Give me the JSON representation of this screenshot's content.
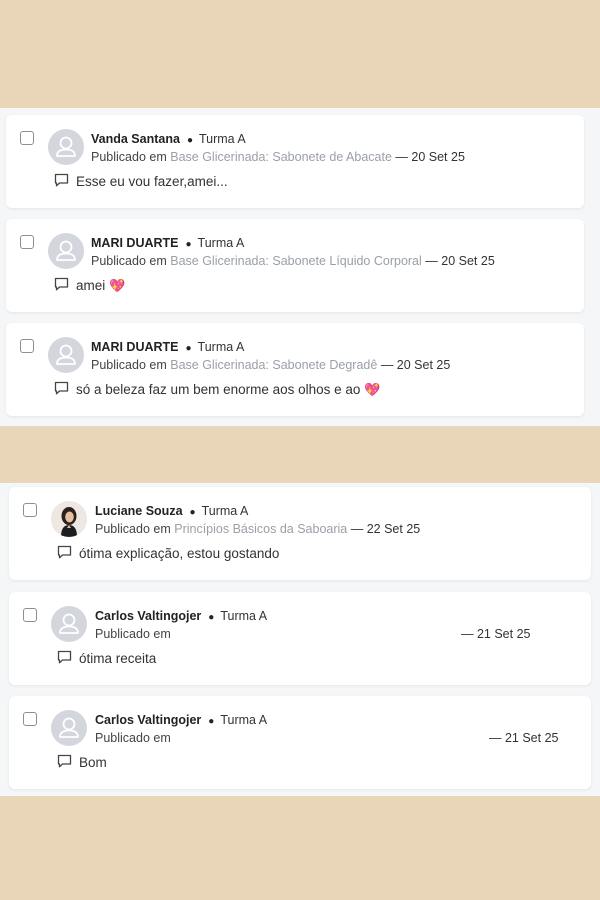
{
  "published_prefix": "Publicado em",
  "top_panel": {
    "comments": [
      {
        "author": "Vanda Santana",
        "class": "Turma A",
        "course": "Base Glicerinada: Sabonete de Abacate",
        "date": "— 20 Set 25",
        "text": "Esse eu vou fazer,amei...",
        "emoji": "",
        "avatar": "placeholder-avatar"
      },
      {
        "author": "MARI DUARTE",
        "class": "Turma A",
        "course": "Base Glicerinada: Sabonete Líquido Corporal",
        "date": "— 20 Set 25",
        "text": "amei",
        "emoji": "💖",
        "avatar": "placeholder-avatar"
      },
      {
        "author": "MARI DUARTE",
        "class": "Turma A",
        "course": "Base Glicerinada: Sabonete Degradê",
        "date": "— 20 Set 25",
        "text": "só a beleza faz um bem enorme aos olhos e ao",
        "emoji": "💖",
        "avatar": "placeholder-avatar"
      }
    ]
  },
  "bottom_panel": {
    "comments": [
      {
        "author": "Luciane Souza",
        "class": "Turma A",
        "course": "Princípios Básicos da Saboaria",
        "date": "— 22 Set 25",
        "text": "ótima explicação, estou gostando",
        "emoji": "",
        "avatar": "photo-avatar"
      },
      {
        "author": "Carlos Valtingojer",
        "class": "Turma A",
        "course": "",
        "date": "— 21 Set 25",
        "text": "ótima receita",
        "emoji": "",
        "avatar": "placeholder-avatar"
      },
      {
        "author": "Carlos Valtingojer",
        "class": "Turma A",
        "course": "",
        "date": "— 21 Set 25",
        "text": "Bom",
        "emoji": "",
        "avatar": "placeholder-avatar"
      }
    ]
  },
  "colors": {
    "background": "#e9d6b8",
    "panel": "#f5f6f8",
    "card": "#ffffff",
    "course_link": "#9aa0a8",
    "heart": "#e0245e"
  }
}
